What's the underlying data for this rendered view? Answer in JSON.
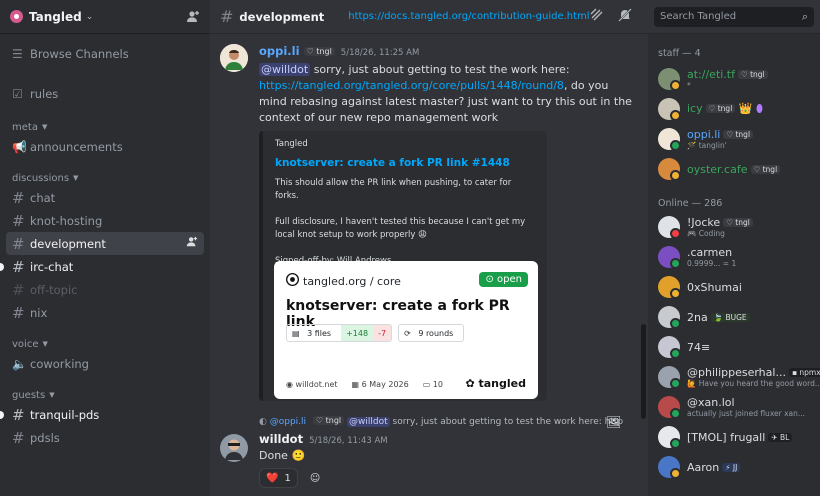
{
  "server": {
    "name": "Tangled"
  },
  "sidebar": {
    "browse": "Browse Channels",
    "rules": "rules",
    "cat_meta": "meta",
    "announcements": "announcements",
    "cat_discussions": "discussions",
    "chat": "chat",
    "knot_hosting": "knot-hosting",
    "development": "development",
    "irc_chat": "irc-chat",
    "off_topic": "off-topic",
    "nix": "nix",
    "cat_voice": "voice",
    "coworking": "coworking",
    "cat_guests": "guests",
    "tranquil_pds": "tranquil-pds",
    "pdsls": "pdsls"
  },
  "header": {
    "channel": "development",
    "topic": "https://docs.tangled.org/contribution-guide.html",
    "search_placeholder": "Search Tangled"
  },
  "messages": {
    "m1": {
      "author": "oppi.li",
      "author_color": "#5aa7ff",
      "tag": "tngl",
      "time": "5/18/26, 11:25 AM",
      "mention": "@willdot",
      "text1": " sorry, just about getting to test the work here:",
      "link": "https://tangled.org/tangled.org/core/pulls/1448/round/8",
      "text2": ", do you mind rebasing against latest master? just want to try this out in the context of our new repo management work"
    },
    "embed": {
      "provider": "Tangled",
      "title": "knotserver: create a fork PR link #1448",
      "p1": "This should allow the PR link when pushing, to cater for forks.",
      "p2": "Full disclosure, I haven't tested this because I can't get my local knot setup to work properly 😩",
      "p3": "Signed-off-by: Will Andrews <did:plc:dadhhalkfcq3gucaq25hjqon>",
      "card": {
        "repo": "tangled.org / core",
        "status": "open",
        "title": "knotserver: create a fork PR link",
        "files": "3 files",
        "additions": "+148",
        "deletions": "-7",
        "rounds": "9 rounds",
        "author": "willdot.net",
        "date": "6 May 2026",
        "comments": "10",
        "brand": "tangled"
      }
    },
    "reply": {
      "to": "@oppi.li",
      "tag": "tngl",
      "mention": "@willdot",
      "preview": " sorry, just about getting to test the work here: http"
    },
    "m2": {
      "author": "willdot",
      "time": "5/18/26, 11:43 AM",
      "text": "Done",
      "emoji": "🙂",
      "reaction_emoji": "❤️",
      "reaction_count": "1"
    }
  },
  "members": {
    "staff_header": "staff — 4",
    "online_header": "Online — 286",
    "staff": [
      {
        "name": "at://eti.tf",
        "tag": "tngl",
        "status": "*",
        "color": "#3ba55d"
      },
      {
        "name": "icy",
        "tag": "tngl",
        "status": "",
        "color": "#3ba55d"
      },
      {
        "name": "oppi.li",
        "tag": "tngl",
        "status": "tanglin'",
        "color": "#5aa7ff"
      },
      {
        "name": "oyster.cafe",
        "tag": "tngl",
        "status": "",
        "color": "#3ba55d"
      }
    ],
    "online": [
      {
        "name": "!Jocke",
        "tag": "tngl",
        "status": "Coding",
        "color": "#dbdee1"
      },
      {
        "name": ".carmen",
        "tag": "",
        "status": "0.9999... = 1",
        "color": "#dbdee1"
      },
      {
        "name": "0xShumai",
        "tag": "",
        "status": "",
        "color": "#dbdee1"
      },
      {
        "name": "2na",
        "tag": "BUGE",
        "status": "",
        "color": "#dbdee1"
      },
      {
        "name": "74≡",
        "tag": "",
        "status": "",
        "color": "#dbdee1"
      },
      {
        "name": "@philippeserhal...",
        "tag": "npmx",
        "status": "Have you heard the good word...",
        "color": "#dbdee1"
      },
      {
        "name": "@xan.lol",
        "tag": "",
        "status": "actually just joined fluxer xan...",
        "color": "#dbdee1"
      },
      {
        "name": "[TMOL] frugall",
        "tag": "BL",
        "status": "",
        "color": "#dbdee1"
      },
      {
        "name": "Aaron",
        "tag": "JJ",
        "status": "",
        "color": "#dbdee1"
      }
    ]
  }
}
